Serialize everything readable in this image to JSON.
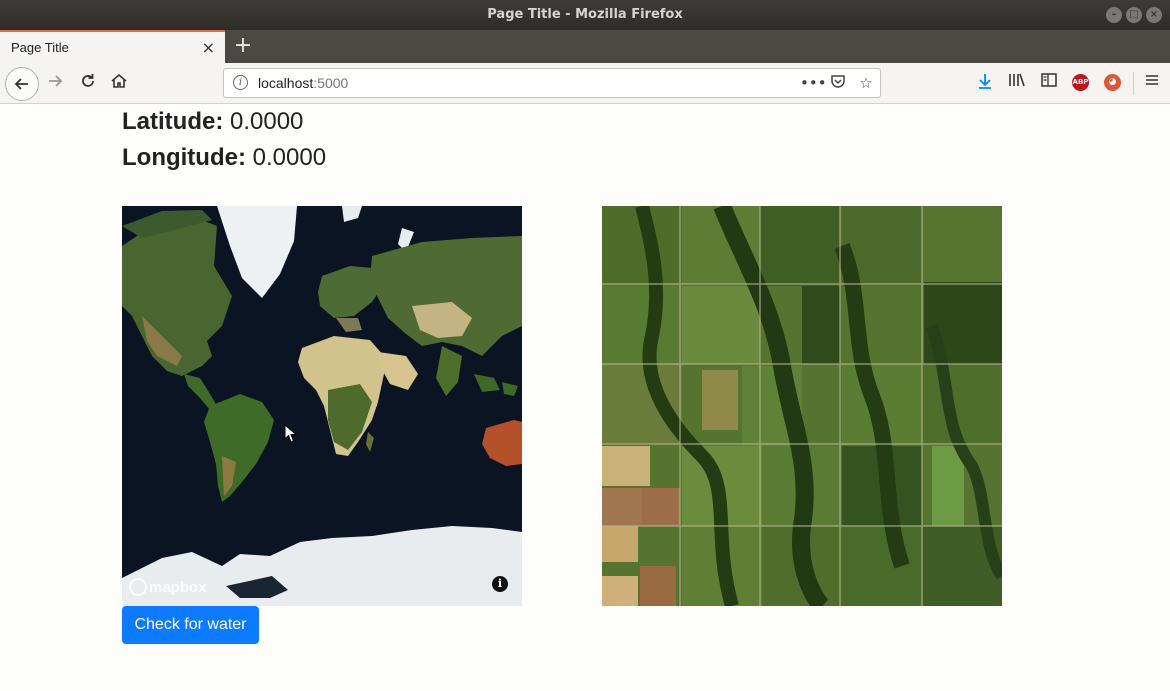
{
  "window": {
    "title": "Page Title - Mozilla Firefox",
    "controls": [
      "–",
      "□",
      "×"
    ]
  },
  "tabs": [
    {
      "label": "Page Title",
      "close": "×"
    }
  ],
  "new_tab": "+",
  "toolbar": {
    "back_icon": "arrow-left-icon",
    "forward_icon": "arrow-right-icon",
    "reload_icon": "reload-icon",
    "home_icon": "home-icon",
    "url_host": "localhost",
    "url_port": ":5000",
    "page_actions": [
      "more-icon",
      "pocket-icon",
      "star-icon"
    ],
    "right_icons": [
      "download-icon",
      "library-icon",
      "sidebar-icon",
      "adblock-icon",
      "duckduckgo-icon",
      "menu-icon"
    ],
    "abp_label": "ABP"
  },
  "page": {
    "latitude_label": "Latitude:",
    "latitude_value": "0.0000",
    "longitude_label": "Longitude:",
    "longitude_value": "0.0000",
    "map_attribution": "mapbox",
    "map_info": "i",
    "check_button": "Check for water"
  },
  "colors": {
    "primary_button": "#0d7bff",
    "tab_accent": "#e36b3b",
    "ocean": "#0b1422"
  }
}
